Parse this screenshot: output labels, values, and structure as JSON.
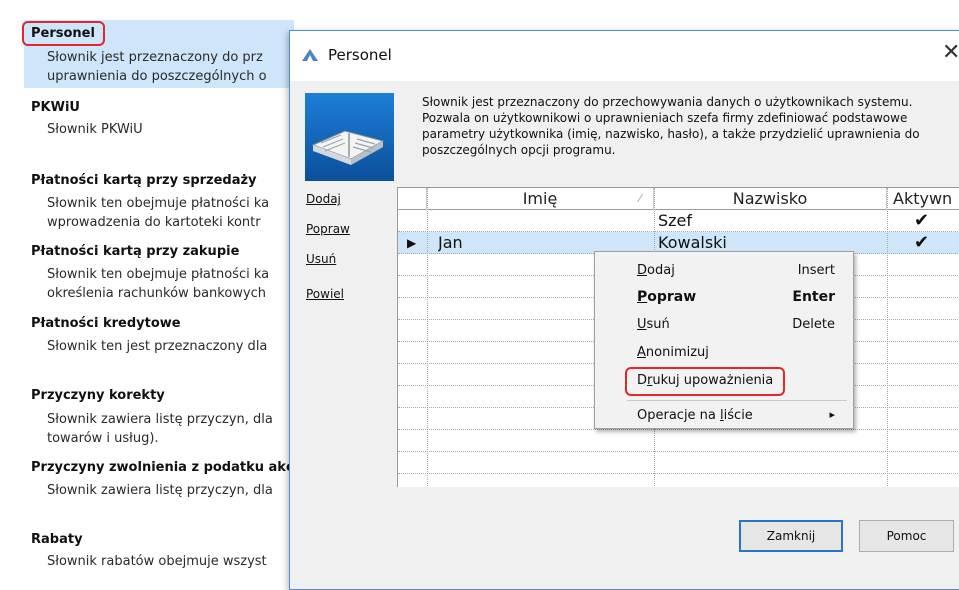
{
  "dictionary_list": [
    {
      "title": "Personel",
      "desc": [
        "Słownik jest przeznaczony do prz",
        "uprawnienia do poszczególnych o"
      ]
    },
    {
      "title": "PKWiU",
      "desc": [
        "Słownik PKWiU"
      ]
    },
    {
      "title": "Płatności kartą przy sprzedaży",
      "desc": [
        "Słownik ten obejmuje płatności ka",
        "wprowadzenia do kartoteki kontr"
      ]
    },
    {
      "title": "Płatności kartą przy zakupie",
      "desc": [
        "Słownik ten obejmuje płatności ka",
        "określenia rachunków bankowych"
      ]
    },
    {
      "title": "Płatności kredytowe",
      "desc": [
        "Słownik ten jest przeznaczony dla"
      ]
    },
    {
      "title": "Przyczyny korekty",
      "desc": [
        "Słownik zawiera listę przyczyn, dla",
        "towarów i usług)."
      ]
    },
    {
      "title": "Przyczyny zwolnienia z podatku akc",
      "desc": [
        "Słownik zawiera listę przyczyn, dla"
      ]
    },
    {
      "title": "Rabaty",
      "desc": [
        "Słownik rabatów obejmuje wszyst"
      ]
    }
  ],
  "dialog": {
    "title": "Personel",
    "close_glyph": "✕",
    "description": "Słownik jest przeznaczony do przechowywania danych o użytkownikach systemu. Pozwala on użytkownikowi o uprawnieniach szefa firmy zdefiniować podstawowe parametry użytkownika (imię, nazwisko, hasło), a także przydzielić uprawnienia do poszczególnych opcji programu.",
    "side_links": [
      "Dodaj",
      "Popraw",
      "Usuń",
      "Powiel"
    ],
    "columns": {
      "first": "Imię",
      "last": "Nazwisko",
      "active": "Aktywn"
    },
    "rows": [
      {
        "first": "",
        "last": "Szef",
        "active": "✔"
      },
      {
        "first": "Jan",
        "last": "Kowalski",
        "active": "✔",
        "selected_marker": "▶"
      }
    ],
    "buttons": {
      "close": "Zamknij",
      "help": "Pomoc"
    }
  },
  "context_menu": {
    "items": [
      {
        "label_pre": "",
        "label_u": "D",
        "label_post": "odaj",
        "shortcut": "Insert"
      },
      {
        "label_pre": "",
        "label_u": "P",
        "label_post": "opraw",
        "shortcut": "Enter"
      },
      {
        "label_pre": "",
        "label_u": "U",
        "label_post": "suń",
        "shortcut": "Delete"
      },
      {
        "label_pre": "",
        "label_u": "A",
        "label_post": "nonimizuj",
        "shortcut": ""
      },
      {
        "label_pre": "D",
        "label_u": "r",
        "label_post": "ukuj upoważnienia",
        "shortcut": ""
      },
      {
        "label_pre": "Operacje na ",
        "label_u": "l",
        "label_post": "iście",
        "shortcut": "▸"
      }
    ]
  },
  "colors": {
    "highlight_red": "#e0272b",
    "selection_blue": "#cfe6fa",
    "dialog_border": "#4f8fd6"
  }
}
